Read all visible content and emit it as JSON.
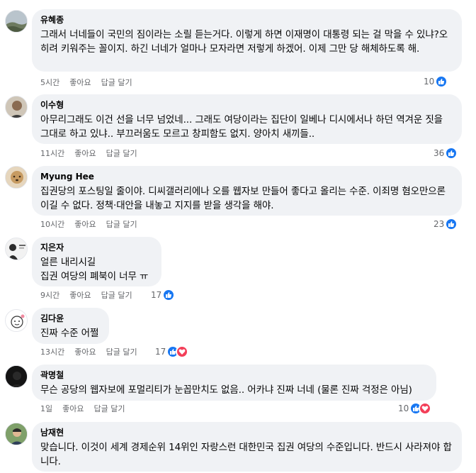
{
  "actions": {
    "like": "좋아요",
    "reply": "답글 달기"
  },
  "comments": [
    {
      "author": "유혜종",
      "text": "그래서 너네들이 국민의 짐이라는 소릴 듣는거다. 이렇게 하면 이재명이 대통령 되는 걸 막을 수 있냐?오히려 키워주는 꼴이지. 하긴 너네가 얼마나 모자라면 저렇게 하겠어. 이제 그만 당 해체하도록 해.",
      "time": "5시간",
      "reaction_count": "10",
      "reactions": [
        "like"
      ]
    },
    {
      "author": "이수형",
      "text": "아무리그래도 이건 선을 너무 넘었네... 그래도 여당이라는 집단이 일베나 디시에서나 하던 역겨운 짓을 그대로 하고 있냐.. 부끄러움도 모르고 창피함도 없지. 양아치 새끼들..",
      "time": "11시간",
      "reaction_count": "36",
      "reactions": [
        "like"
      ]
    },
    {
      "author": "Myung Hee",
      "text": "집권당의 포스팅일 줄이야. 디씨갤러리에나 오를 웹자보 만들어 좋다고 올리는 수준. 이죄명 혐오만으론 이길 수 없다. 정책·대안을 내놓고 지지를 받을 생각을 해야.",
      "time": "10시간",
      "reaction_count": "23",
      "reactions": [
        "like"
      ]
    },
    {
      "author": "지은자",
      "text": "얼른 내리시길\n집권 여당의 폐북이 너무 ㅠ",
      "time": "9시간",
      "reaction_count": "17",
      "reactions": [
        "like"
      ]
    },
    {
      "author": "김다윤",
      "text": "진짜 수준 어쩔",
      "time": "13시간",
      "reaction_count": "17",
      "reactions": [
        "like",
        "love"
      ]
    },
    {
      "author": "곽명철",
      "text": "무슨 공당의 웹자보에 포멀리티가 눈꼽만치도 없음.. 어카냐 진짜 너네 (물론 진짜 걱정은 아님)",
      "time": "1일",
      "reaction_count": "10",
      "reactions": [
        "like",
        "love"
      ]
    },
    {
      "author": "남재현",
      "text": "맞습니다. 이것이 세계 경제순위 14위인 자랑스런 대한민국 집권 여당의 수준입니다. 반드시 사라져야 합니다.",
      "time": "",
      "reaction_count": "",
      "reactions": []
    }
  ]
}
